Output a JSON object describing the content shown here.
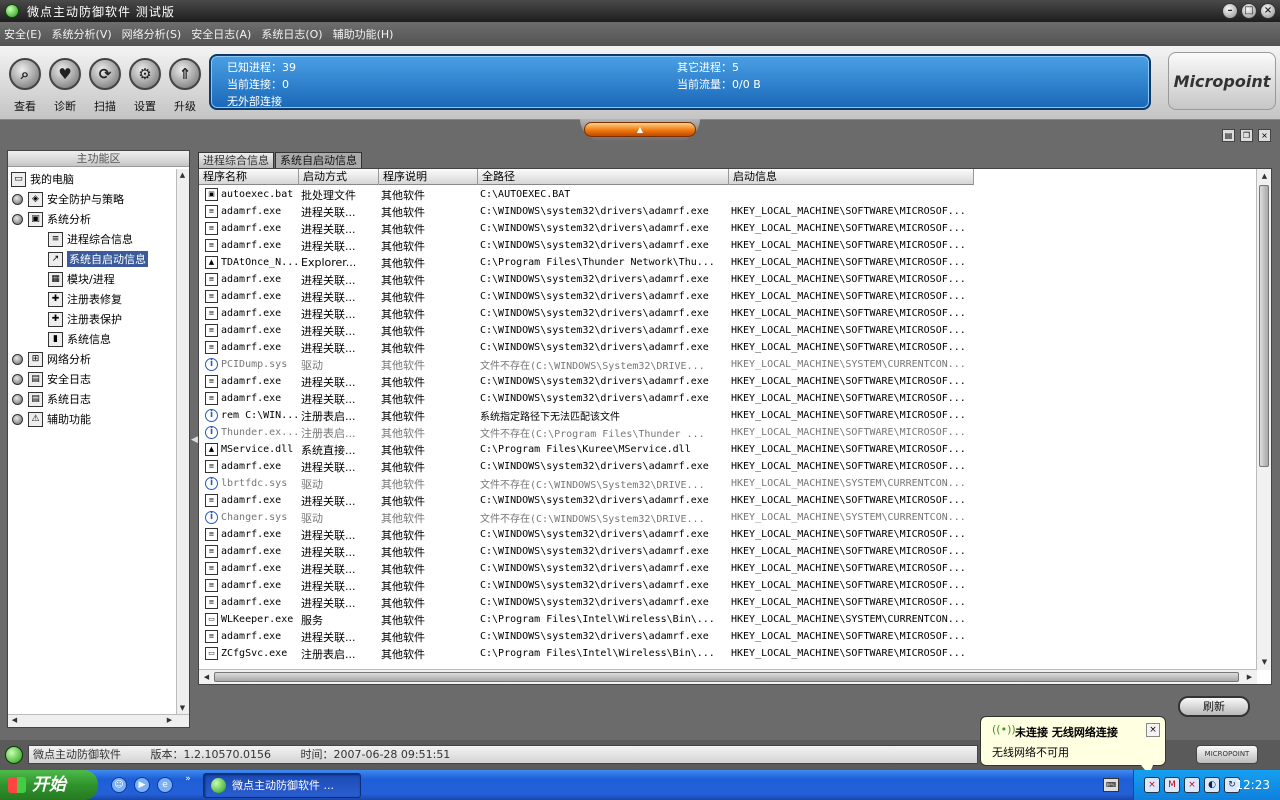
{
  "window": {
    "title": "微点主动防御软件   测试版"
  },
  "menu": [
    "安全(E)",
    "系统分析(V)",
    "网络分析(S)",
    "安全日志(A)",
    "系统日志(O)",
    "辅助功能(H)"
  ],
  "toolbar": [
    {
      "label": "查看",
      "icon": "magnifier-icon"
    },
    {
      "label": "诊断",
      "icon": "heart-icon"
    },
    {
      "label": "扫描",
      "icon": "scan-icon"
    },
    {
      "label": "设置",
      "icon": "gear-icon"
    },
    {
      "label": "升级",
      "icon": "upgrade-icon"
    }
  ],
  "status": {
    "known_processes": "已知进程：39",
    "other_processes": "其它进程：5",
    "current_connections": "当前连接：0",
    "current_traffic": "当前流量：0/0 B",
    "external": "无外部连接"
  },
  "logo": "Micropoint",
  "left_panel": {
    "header": "主功能区",
    "tree": [
      {
        "label": "我的电脑",
        "level": 0,
        "expander": false,
        "icon": "computer-icon",
        "selected": false
      },
      {
        "label": "安全防护与策略",
        "level": 1,
        "expander": true,
        "icon": "shield-icon",
        "selected": false
      },
      {
        "label": "系统分析",
        "level": 1,
        "expander": true,
        "icon": "monitor-icon",
        "selected": false
      },
      {
        "label": "进程综合信息",
        "level": 2,
        "expander": false,
        "icon": "process-info-icon",
        "selected": false
      },
      {
        "label": "系统自启动信息",
        "level": 2,
        "expander": false,
        "icon": "startup-icon",
        "selected": true
      },
      {
        "label": "模块/进程",
        "level": 2,
        "expander": false,
        "icon": "module-icon",
        "selected": false
      },
      {
        "label": "注册表修复",
        "level": 2,
        "expander": false,
        "icon": "registry-repair-icon",
        "selected": false
      },
      {
        "label": "注册表保护",
        "level": 2,
        "expander": false,
        "icon": "registry-protect-icon",
        "selected": false
      },
      {
        "label": "系统信息",
        "level": 2,
        "expander": false,
        "icon": "system-info-icon",
        "selected": false
      },
      {
        "label": "网络分析",
        "level": 1,
        "expander": true,
        "icon": "network-icon",
        "selected": false
      },
      {
        "label": "安全日志",
        "level": 1,
        "expander": true,
        "icon": "security-log-icon",
        "selected": false
      },
      {
        "label": "系统日志",
        "level": 1,
        "expander": true,
        "icon": "system-log-icon",
        "selected": false
      },
      {
        "label": "辅助功能",
        "level": 1,
        "expander": true,
        "icon": "tools-icon",
        "selected": false
      }
    ]
  },
  "tabs": [
    {
      "label": "进程综合信息",
      "active": false
    },
    {
      "label": "系统自启动信息",
      "active": true
    }
  ],
  "table": {
    "columns": [
      "程序名称",
      "启动方式",
      "程序说明",
      "全路径",
      "启动信息"
    ],
    "rows": [
      {
        "icon": "batch-file-icon",
        "gray": false,
        "name": "autoexec.bat",
        "method": "批处理文件",
        "desc": "其他软件",
        "path": "C:\\AUTOEXEC.BAT",
        "info": ""
      },
      {
        "icon": "file-icon",
        "gray": false,
        "name": "adamrf.exe",
        "method": "进程关联...",
        "desc": "其他软件",
        "path": "C:\\WINDOWS\\system32\\drivers\\adamrf.exe",
        "info": "HKEY_LOCAL_MACHINE\\SOFTWARE\\MICROSOF..."
      },
      {
        "icon": "file-icon",
        "gray": false,
        "name": "adamrf.exe",
        "method": "进程关联...",
        "desc": "其他软件",
        "path": "C:\\WINDOWS\\system32\\drivers\\adamrf.exe",
        "info": "HKEY_LOCAL_MACHINE\\SOFTWARE\\MICROSOF..."
      },
      {
        "icon": "file-icon",
        "gray": false,
        "name": "adamrf.exe",
        "method": "进程关联...",
        "desc": "其他软件",
        "path": "C:\\WINDOWS\\system32\\drivers\\adamrf.exe",
        "info": "HKEY_LOCAL_MACHINE\\SOFTWARE\\MICROSOF..."
      },
      {
        "icon": "app-icon",
        "gray": false,
        "name": "TDAtOnce_N...",
        "method": "Explorer...",
        "desc": "其他软件",
        "path": "C:\\Program Files\\Thunder Network\\Thu...",
        "info": "HKEY_LOCAL_MACHINE\\SOFTWARE\\MICROSOF..."
      },
      {
        "icon": "file-icon",
        "gray": false,
        "name": "adamrf.exe",
        "method": "进程关联...",
        "desc": "其他软件",
        "path": "C:\\WINDOWS\\system32\\drivers\\adamrf.exe",
        "info": "HKEY_LOCAL_MACHINE\\SOFTWARE\\MICROSOF..."
      },
      {
        "icon": "file-icon",
        "gray": false,
        "name": "adamrf.exe",
        "method": "进程关联...",
        "desc": "其他软件",
        "path": "C:\\WINDOWS\\system32\\drivers\\adamrf.exe",
        "info": "HKEY_LOCAL_MACHINE\\SOFTWARE\\MICROSOF..."
      },
      {
        "icon": "file-icon",
        "gray": false,
        "name": "adamrf.exe",
        "method": "进程关联...",
        "desc": "其他软件",
        "path": "C:\\WINDOWS\\system32\\drivers\\adamrf.exe",
        "info": "HKEY_LOCAL_MACHINE\\SOFTWARE\\MICROSOF..."
      },
      {
        "icon": "file-icon",
        "gray": false,
        "name": "adamrf.exe",
        "method": "进程关联...",
        "desc": "其他软件",
        "path": "C:\\WINDOWS\\system32\\drivers\\adamrf.exe",
        "info": "HKEY_LOCAL_MACHINE\\SOFTWARE\\MICROSOF..."
      },
      {
        "icon": "file-icon",
        "gray": false,
        "name": "adamrf.exe",
        "method": "进程关联...",
        "desc": "其他软件",
        "path": "C:\\WINDOWS\\system32\\drivers\\adamrf.exe",
        "info": "HKEY_LOCAL_MACHINE\\SOFTWARE\\MICROSOF..."
      },
      {
        "icon": "info-icon",
        "gray": true,
        "name": "PCIDump.sys",
        "method": "驱动",
        "desc": "其他软件",
        "path": "文件不存在(C:\\WINDOWS\\System32\\DRIVE...",
        "info": "HKEY_LOCAL_MACHINE\\SYSTEM\\CURRENTCON..."
      },
      {
        "icon": "file-icon",
        "gray": false,
        "name": "adamrf.exe",
        "method": "进程关联...",
        "desc": "其他软件",
        "path": "C:\\WINDOWS\\system32\\drivers\\adamrf.exe",
        "info": "HKEY_LOCAL_MACHINE\\SOFTWARE\\MICROSOF..."
      },
      {
        "icon": "file-icon",
        "gray": false,
        "name": "adamrf.exe",
        "method": "进程关联...",
        "desc": "其他软件",
        "path": "C:\\WINDOWS\\system32\\drivers\\adamrf.exe",
        "info": "HKEY_LOCAL_MACHINE\\SOFTWARE\\MICROSOF..."
      },
      {
        "icon": "info-icon",
        "gray": false,
        "name": "rem C:\\WIN...",
        "method": "注册表启...",
        "desc": "其他软件",
        "path": "系统指定路径下无法匹配该文件",
        "info": "HKEY_LOCAL_MACHINE\\SOFTWARE\\MICROSOF..."
      },
      {
        "icon": "info-icon",
        "gray": true,
        "name": "Thunder.ex...",
        "method": "注册表启...",
        "desc": "其他软件",
        "path": "文件不存在(C:\\Program Files\\Thunder ...",
        "info": "HKEY_LOCAL_MACHINE\\SOFTWARE\\MICROSOF..."
      },
      {
        "icon": "app-icon",
        "gray": false,
        "name": "MService.dll",
        "method": "系统直接...",
        "desc": "其他软件",
        "path": "C:\\Program Files\\Kuree\\MService.dll",
        "info": "HKEY_LOCAL_MACHINE\\SOFTWARE\\MICROSOF..."
      },
      {
        "icon": "file-icon",
        "gray": false,
        "name": "adamrf.exe",
        "method": "进程关联...",
        "desc": "其他软件",
        "path": "C:\\WINDOWS\\system32\\drivers\\adamrf.exe",
        "info": "HKEY_LOCAL_MACHINE\\SOFTWARE\\MICROSOF..."
      },
      {
        "icon": "info-icon",
        "gray": true,
        "name": "lbrtfdc.sys",
        "method": "驱动",
        "desc": "其他软件",
        "path": "文件不存在(C:\\WINDOWS\\System32\\DRIVE...",
        "info": "HKEY_LOCAL_MACHINE\\SYSTEM\\CURRENTCON..."
      },
      {
        "icon": "file-icon",
        "gray": false,
        "name": "adamrf.exe",
        "method": "进程关联...",
        "desc": "其他软件",
        "path": "C:\\WINDOWS\\system32\\drivers\\adamrf.exe",
        "info": "HKEY_LOCAL_MACHINE\\SOFTWARE\\MICROSOF..."
      },
      {
        "icon": "info-icon",
        "gray": true,
        "name": "Changer.sys",
        "method": "驱动",
        "desc": "其他软件",
        "path": "文件不存在(C:\\WINDOWS\\System32\\DRIVE...",
        "info": "HKEY_LOCAL_MACHINE\\SYSTEM\\CURRENTCON..."
      },
      {
        "icon": "file-icon",
        "gray": false,
        "name": "adamrf.exe",
        "method": "进程关联...",
        "desc": "其他软件",
        "path": "C:\\WINDOWS\\system32\\drivers\\adamrf.exe",
        "info": "HKEY_LOCAL_MACHINE\\SOFTWARE\\MICROSOF..."
      },
      {
        "icon": "file-icon",
        "gray": false,
        "name": "adamrf.exe",
        "method": "进程关联...",
        "desc": "其他软件",
        "path": "C:\\WINDOWS\\system32\\drivers\\adamrf.exe",
        "info": "HKEY_LOCAL_MACHINE\\SOFTWARE\\MICROSOF..."
      },
      {
        "icon": "file-icon",
        "gray": false,
        "name": "adamrf.exe",
        "method": "进程关联...",
        "desc": "其他软件",
        "path": "C:\\WINDOWS\\system32\\drivers\\adamrf.exe",
        "info": "HKEY_LOCAL_MACHINE\\SOFTWARE\\MICROSOF..."
      },
      {
        "icon": "file-icon",
        "gray": false,
        "name": "adamrf.exe",
        "method": "进程关联...",
        "desc": "其他软件",
        "path": "C:\\WINDOWS\\system32\\drivers\\adamrf.exe",
        "info": "HKEY_LOCAL_MACHINE\\SOFTWARE\\MICROSOF..."
      },
      {
        "icon": "file-icon",
        "gray": false,
        "name": "adamrf.exe",
        "method": "进程关联...",
        "desc": "其他软件",
        "path": "C:\\WINDOWS\\system32\\drivers\\adamrf.exe",
        "info": "HKEY_LOCAL_MACHINE\\SOFTWARE\\MICROSOF..."
      },
      {
        "icon": "window-icon",
        "gray": false,
        "name": "WLKeeper.exe",
        "method": "服务",
        "desc": "其他软件",
        "path": "C:\\Program Files\\Intel\\Wireless\\Bin\\...",
        "info": "HKEY_LOCAL_MACHINE\\SYSTEM\\CURRENTCON..."
      },
      {
        "icon": "file-icon",
        "gray": false,
        "name": "adamrf.exe",
        "method": "进程关联...",
        "desc": "其他软件",
        "path": "C:\\WINDOWS\\system32\\drivers\\adamrf.exe",
        "info": "HKEY_LOCAL_MACHINE\\SOFTWARE\\MICROSOF..."
      },
      {
        "icon": "window-icon",
        "gray": false,
        "name": "ZCfgSvc.exe",
        "method": "注册表启...",
        "desc": "其他软件",
        "path": "C:\\Program Files\\Intel\\Wireless\\Bin\\...",
        "info": "HKEY_LOCAL_MACHINE\\SOFTWARE\\MICROSOF..."
      }
    ]
  },
  "refresh_label": "刷新",
  "statusbar": {
    "app": "微点主动防御软件",
    "version": "版本：1.2.10570.0156",
    "time": "时间：2007-06-28 09:51:51",
    "logo": "MICROPOINT"
  },
  "balloon": {
    "title": "未连接 无线网络连接",
    "body": "无线网络不可用"
  },
  "taskbar": {
    "start": "开始",
    "task": "微点主动防御软件 ...",
    "clock": "12:23"
  }
}
